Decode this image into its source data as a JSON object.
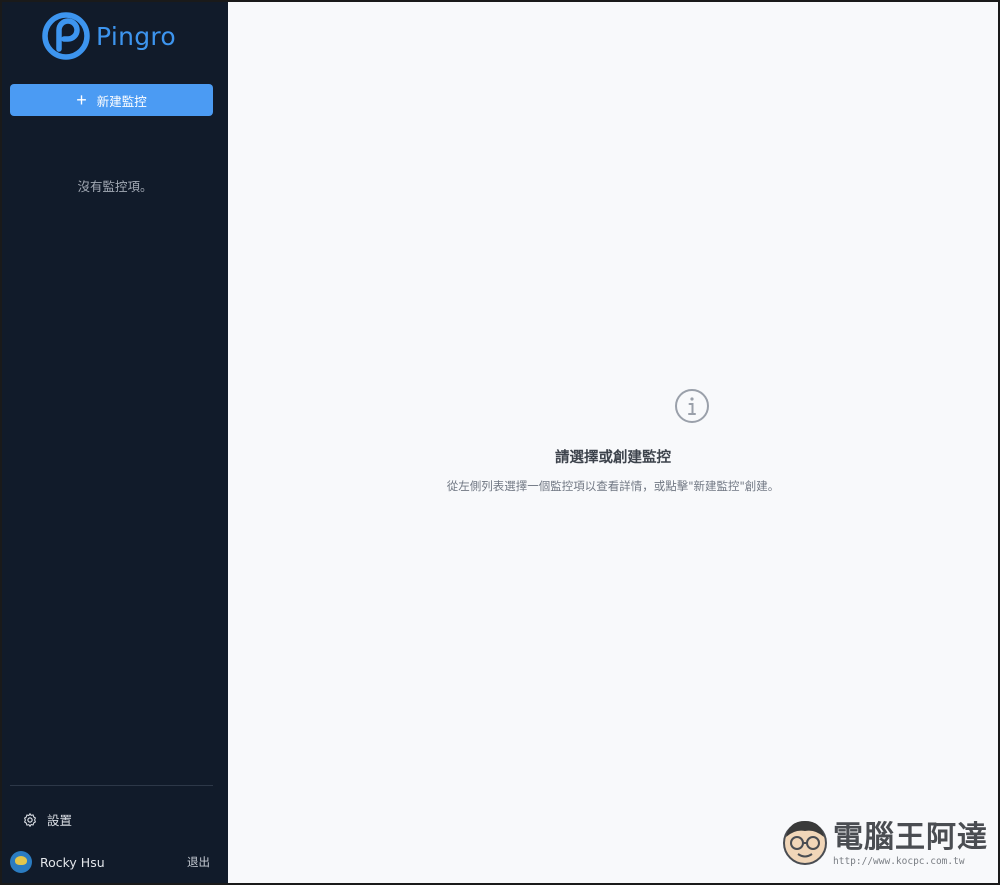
{
  "app": {
    "logo_text": "Pingro",
    "brand_color": "#3d95ef"
  },
  "sidebar": {
    "new_monitor_button": "新建監控",
    "new_monitor_icon": "plus-icon",
    "empty_message": "沒有監控項。",
    "settings_label": "設置",
    "settings_icon": "gear-icon",
    "user": {
      "name": "Rocky Hsu",
      "logout_label": "退出"
    },
    "background_color": "#111b2a",
    "button_color": "#4b9bf3"
  },
  "main": {
    "icon": "info-circle-icon",
    "title": "請選擇或創建監控",
    "subtitle": "從左側列表選擇一個監控項以查看詳情，或點擊\"新建監控\"創建。",
    "background_color": "#f8f9fb"
  },
  "watermark": {
    "title": "電腦王阿達",
    "url": "http://www.kocpc.com.tw"
  }
}
